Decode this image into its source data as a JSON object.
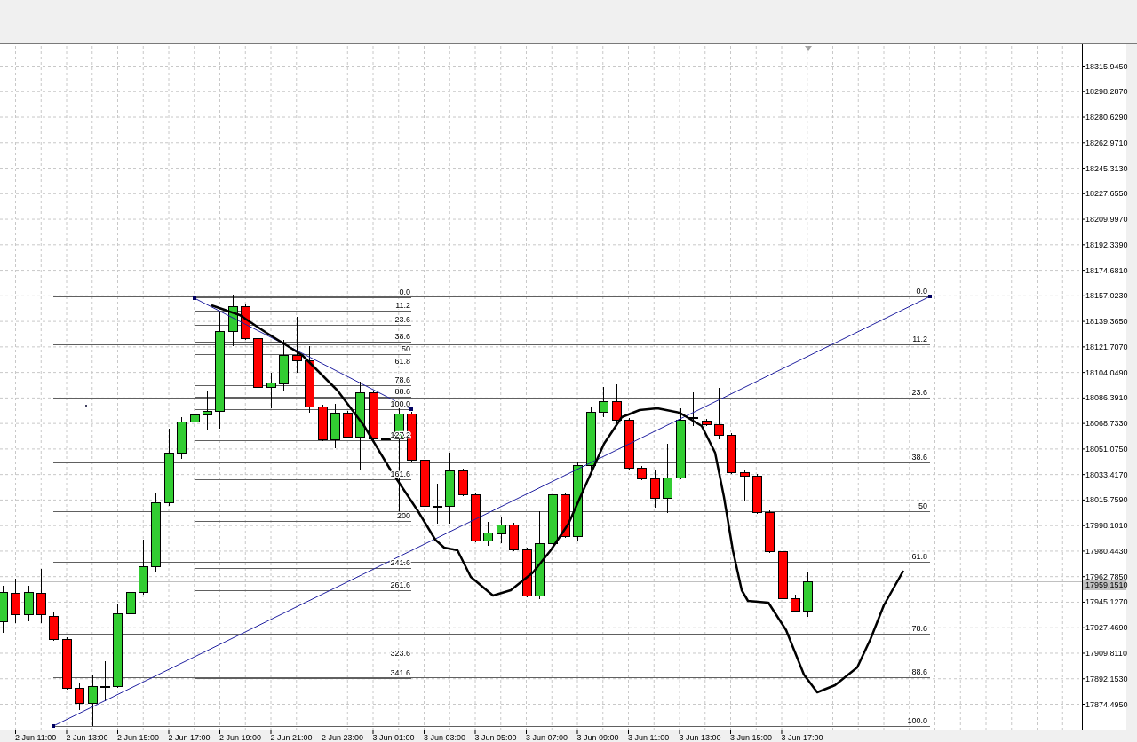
{
  "price_axis": {
    "labels": [
      "18315.9450",
      "18298.2870",
      "18280.6290",
      "18262.9710",
      "18245.3130",
      "18227.6550",
      "18209.9970",
      "18192.3390",
      "18174.6810",
      "18157.0230",
      "18139.3650",
      "18121.7070",
      "18104.0490",
      "18086.3910",
      "18068.7330",
      "18051.0750",
      "18033.4170",
      "18015.7590",
      "17998.1010",
      "17980.4430",
      "17962.7850",
      "17945.1270",
      "17927.4690",
      "17909.8110",
      "17892.1530",
      "17874.4950"
    ],
    "current_price": "17959.1510"
  },
  "time_axis": {
    "labels": [
      "2 Jun 11:00",
      "2 Jun 13:00",
      "2 Jun 15:00",
      "2 Jun 17:00",
      "2 Jun 19:00",
      "2 Jun 21:00",
      "2 Jun 23:00",
      "3 Jun 01:00",
      "3 Jun 03:00",
      "3 Jun 05:00",
      "3 Jun 07:00",
      "3 Jun 09:00",
      "3 Jun 11:00",
      "3 Jun 13:00",
      "3 Jun 15:00",
      "3 Jun 17:00"
    ]
  },
  "fibonacci_retracement": {
    "levels": [
      "0.0",
      "11.2",
      "23.6",
      "38.6",
      "50",
      "61.8",
      "78.6",
      "88.6",
      "100.0"
    ]
  },
  "fibonacci_expansion": {
    "levels": [
      "0.0",
      "11.2",
      "23.6",
      "38.6",
      "50",
      "61.8",
      "78.6",
      "88.6",
      "100.0",
      "127.2",
      "161.6",
      "200",
      "241.6",
      "261.6",
      "323.6",
      "341.6"
    ]
  }
}
